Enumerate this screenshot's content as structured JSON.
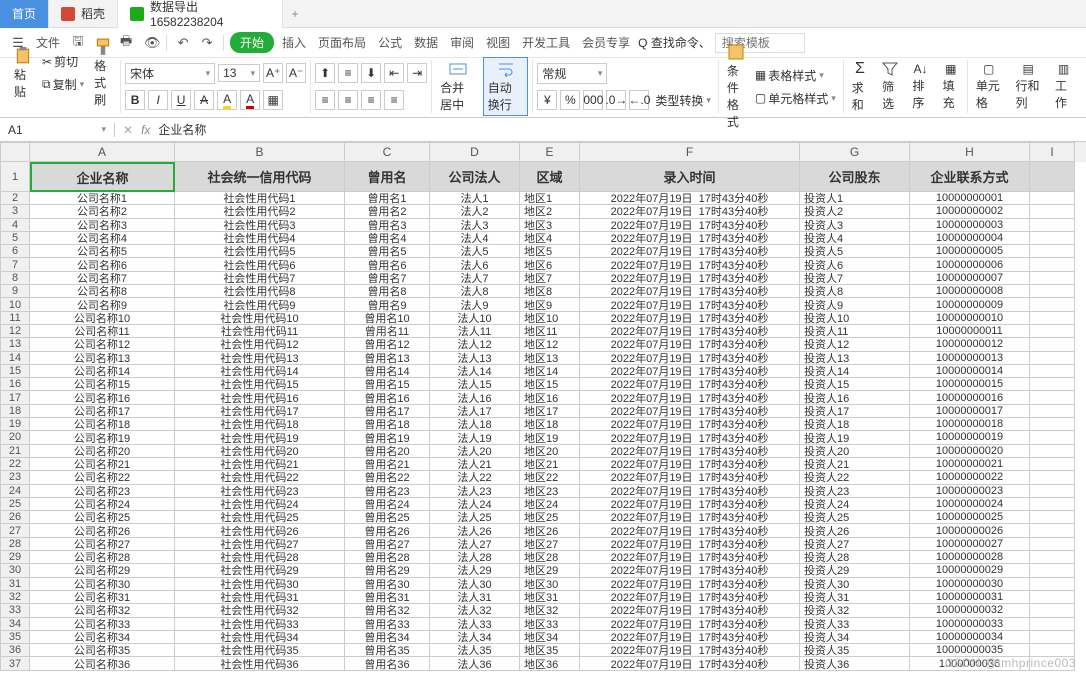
{
  "tabs": {
    "home": "首页",
    "doc": "稻壳",
    "sheet": "数据导出16582238204",
    "add": "+"
  },
  "menu": {
    "file": "文件",
    "start": "开始",
    "insert": "插入",
    "layout": "页面布局",
    "formula": "公式",
    "data": "数据",
    "review": "审阅",
    "view": "视图",
    "dev": "开发工具",
    "member": "会员专享",
    "searchHint": "Q 查找命令、",
    "searchPh": "搜索模板"
  },
  "ribbon": {
    "paste": "粘贴",
    "cut": "剪切",
    "copy": "复制",
    "brush": "格式刷",
    "font": "宋体",
    "size": "13",
    "merge": "合并居中",
    "wrap": "自动换行",
    "numfmt": "常规",
    "typeconv": "类型转换",
    "condfmt": "条件格式",
    "tablestyle": "表格样式",
    "cellstyle": "单元格样式",
    "sum": "求和",
    "filter": "筛选",
    "sort": "排序",
    "fill": "填充",
    "cell": "单元格",
    "rowcol": "行和列",
    "work": "工作"
  },
  "fx": {
    "cell": "A1",
    "value": "企业名称"
  },
  "colw": {
    "A": "A",
    "B": "B",
    "C": "C",
    "D": "D",
    "E": "E",
    "F": "F",
    "G": "G",
    "H": "H",
    "I": "I"
  },
  "headers": [
    "企业名称",
    "社会统一信用代码",
    "曾用名",
    "公司法人",
    "区域",
    "录入时间",
    "公司股东",
    "企业联系方式"
  ],
  "datePart": "2022年07月19日",
  "timePart": "17时43分40秒",
  "prefixes": {
    "name": "公司名称",
    "code": "社会性用代码",
    "used": "曾用名",
    "legal": "法人",
    "area": "地区",
    "inv": "投资人"
  },
  "phoneBase": 10000000000,
  "rowCount": 36,
  "lastPhone": "1000000036",
  "watermark": "CSDN @tmhprince003"
}
